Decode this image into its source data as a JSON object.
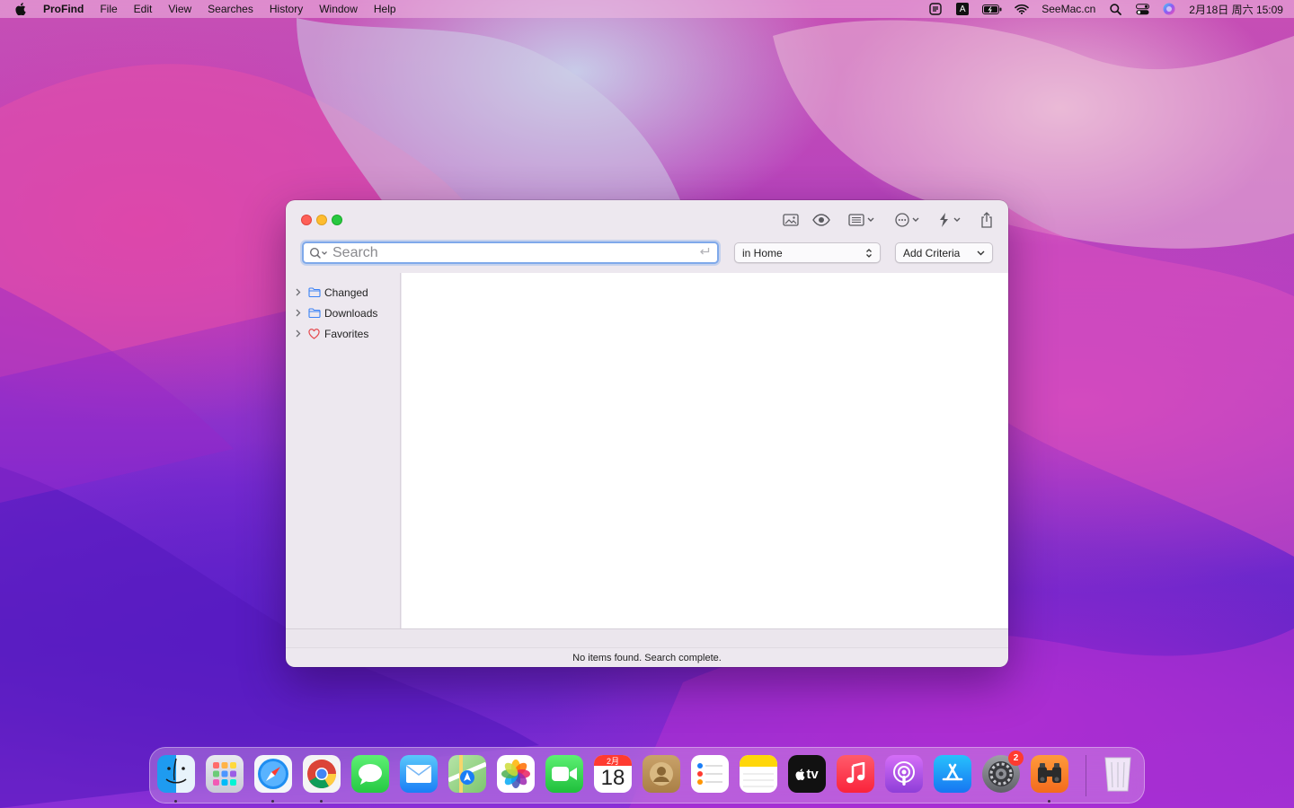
{
  "menubar": {
    "app_name": "ProFind",
    "menus": [
      "File",
      "Edit",
      "View",
      "Searches",
      "History",
      "Window",
      "Help"
    ],
    "input_source_label": "A",
    "site_label": "SeeMac.cn",
    "datetime": "2月18日 周六 15:09"
  },
  "window": {
    "search": {
      "placeholder": "Search",
      "value": ""
    },
    "scope_popup": {
      "selected": "in Home"
    },
    "criteria_popup": {
      "label": "Add Criteria"
    },
    "sidebar": {
      "items": [
        {
          "label": "Changed",
          "icon": "folder-icon"
        },
        {
          "label": "Downloads",
          "icon": "folder-icon"
        },
        {
          "label": "Favorites",
          "icon": "heart-icon"
        }
      ]
    },
    "status": "No items found. Search complete."
  },
  "dock": {
    "apps": [
      {
        "name": "Finder",
        "icon": "finder-icon",
        "running": true
      },
      {
        "name": "Launchpad",
        "icon": "launchpad-icon",
        "running": false
      },
      {
        "name": "Safari",
        "icon": "safari-icon",
        "running": true
      },
      {
        "name": "Chrome",
        "icon": "chrome-icon",
        "running": true
      },
      {
        "name": "Messages",
        "icon": "messages-icon",
        "running": false
      },
      {
        "name": "Mail",
        "icon": "mail-icon",
        "running": false
      },
      {
        "name": "Maps",
        "icon": "maps-icon",
        "running": false
      },
      {
        "name": "Photos",
        "icon": "photos-icon",
        "running": false
      },
      {
        "name": "FaceTime",
        "icon": "facetime-icon",
        "running": false
      },
      {
        "name": "Calendar",
        "icon": "calendar-icon",
        "running": false
      },
      {
        "name": "Contacts",
        "icon": "contacts-icon",
        "running": false
      },
      {
        "name": "Reminders",
        "icon": "reminders-icon",
        "running": false
      },
      {
        "name": "Notes",
        "icon": "notes-icon",
        "running": false
      },
      {
        "name": "TV",
        "icon": "tv-icon",
        "running": false
      },
      {
        "name": "Music",
        "icon": "music-icon",
        "running": false
      },
      {
        "name": "Podcasts",
        "icon": "podcasts-icon",
        "running": false
      },
      {
        "name": "App Store",
        "icon": "appstore-icon",
        "running": false
      },
      {
        "name": "System Preferences",
        "icon": "settings-icon",
        "running": false
      },
      {
        "name": "ProFind",
        "icon": "profind-icon",
        "running": true
      }
    ],
    "calendar_month": "2月",
    "calendar_day": "18",
    "tv_label": "tv",
    "settings_badge": "2",
    "trash": {
      "icon": "trash-icon"
    }
  },
  "colors": {
    "close": "#fe5f57",
    "minimize": "#febc2e",
    "zoom": "#28c840",
    "focus_ring": "#7fa9ea"
  }
}
